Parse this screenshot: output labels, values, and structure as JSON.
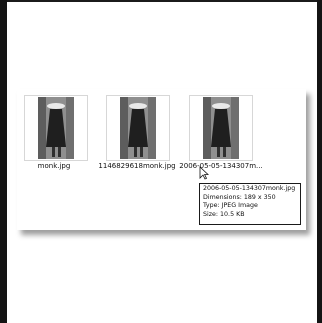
{
  "files": [
    {
      "name": "monk.jpg",
      "thumbnail": "monk-photo-thumbnail"
    },
    {
      "name": "1146829618monk.jpg",
      "thumbnail": "monk-photo-thumbnail"
    },
    {
      "name": "2006-05-05-134307m...",
      "thumbnail": "monk-photo-thumbnail"
    }
  ],
  "tooltip": {
    "filename": "2006-05-05-134307monk.jpg",
    "dimensions": "Dimensions: 189 x 350",
    "type": "Type: JPEG Image",
    "size": "Size: 10.5 KB"
  },
  "icons": {
    "cursor": "arrow-cursor-icon"
  },
  "colors": {
    "window_border": "#141414",
    "background": "#ffffff",
    "tooltip_border": "#1a1a1a"
  }
}
